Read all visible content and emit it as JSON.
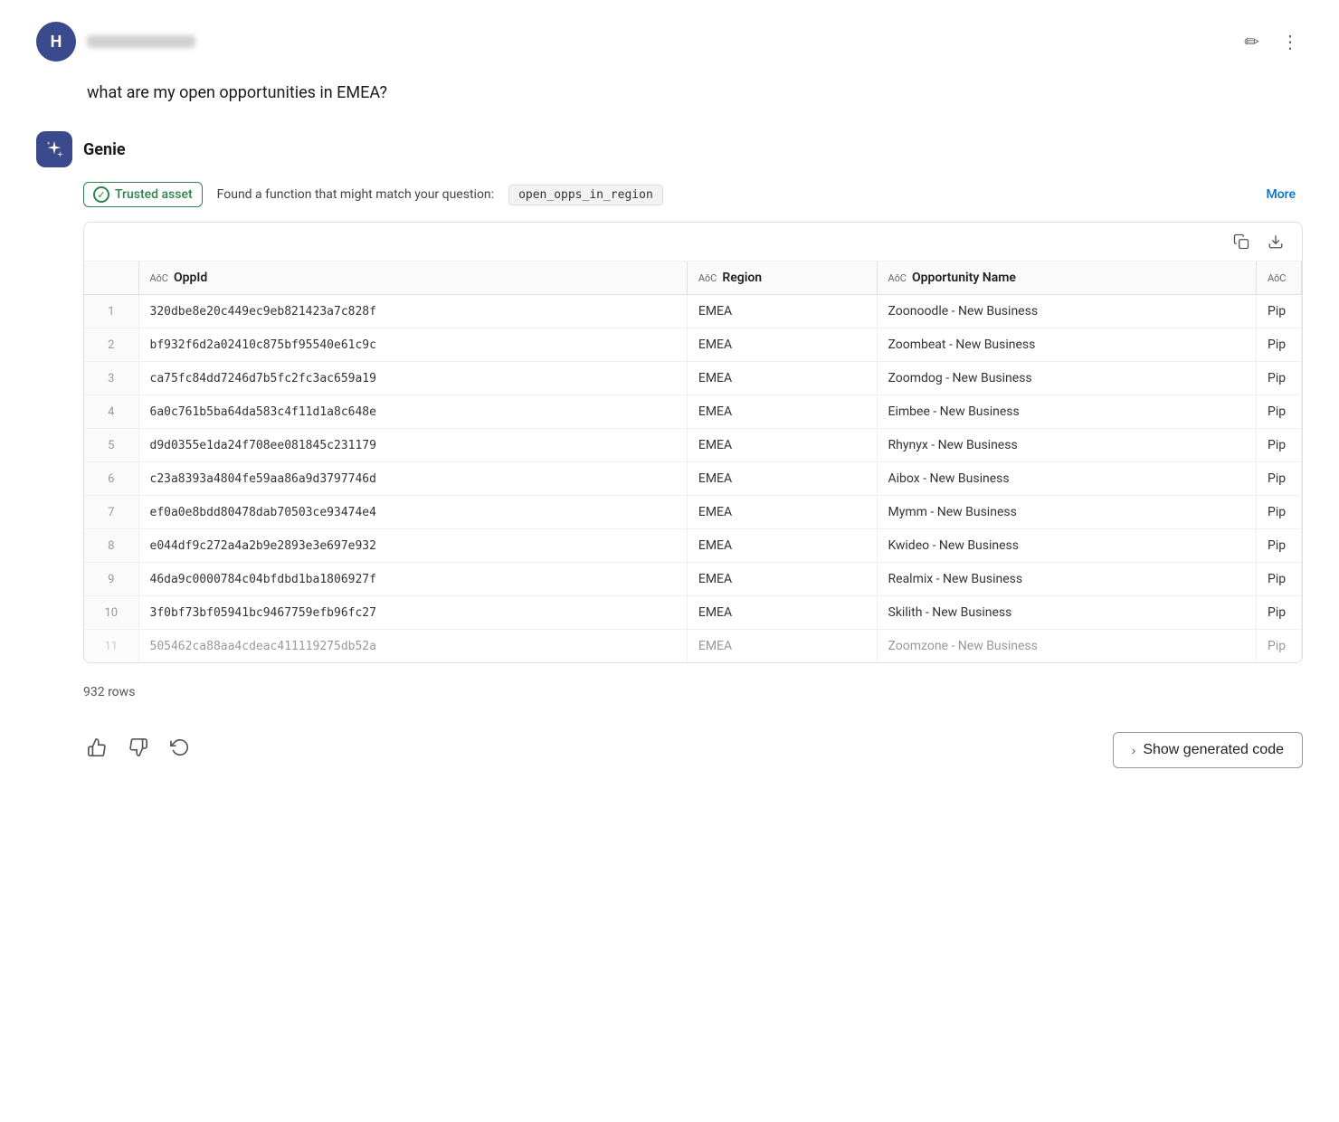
{
  "header": {
    "avatar_letter": "H",
    "edit_icon": "✏",
    "more_icon": "⋮"
  },
  "question": {
    "text": "what are my open opportunities in EMEA?"
  },
  "genie": {
    "name": "Genie",
    "trusted_label": "Trusted asset",
    "found_text": "Found a function that might match your question:",
    "function_name": "open_opps_in_region",
    "more_label": "More"
  },
  "table": {
    "copy_icon": "⧉",
    "download_icon": "↓",
    "columns": [
      {
        "label": "OppId",
        "type": "ABC"
      },
      {
        "label": "Region",
        "type": "ABC"
      },
      {
        "label": "Opportunity Name",
        "type": "ABC"
      },
      {
        "label": "...",
        "type": "ABC"
      }
    ],
    "rows": [
      {
        "num": "1",
        "opp_id": "320dbe8e20c449ec9eb821423a7c828f",
        "region": "EMEA",
        "opp_name": "Zoonoodle - New Business",
        "partial": "Pip"
      },
      {
        "num": "2",
        "opp_id": "bf932f6d2a02410c875bf95540e61c9c",
        "region": "EMEA",
        "opp_name": "Zoombeat - New Business",
        "partial": "Pip"
      },
      {
        "num": "3",
        "opp_id": "ca75fc84dd7246d7b5fc2fc3ac659a19",
        "region": "EMEA",
        "opp_name": "Zoomdog - New Business",
        "partial": "Pip"
      },
      {
        "num": "4",
        "opp_id": "6a0c761b5ba64da583c4f11d1a8c648e",
        "region": "EMEA",
        "opp_name": "Eimbee - New Business",
        "partial": "Pip"
      },
      {
        "num": "5",
        "opp_id": "d9d0355e1da24f708ee081845c231179",
        "region": "EMEA",
        "opp_name": "Rhynyx - New Business",
        "partial": "Pip"
      },
      {
        "num": "6",
        "opp_id": "c23a8393a4804fe59aa86a9d3797746d",
        "region": "EMEA",
        "opp_name": "Aibox - New Business",
        "partial": "Pip"
      },
      {
        "num": "7",
        "opp_id": "ef0a0e8bdd80478dab70503ce93474e4",
        "region": "EMEA",
        "opp_name": "Mymm - New Business",
        "partial": "Pip"
      },
      {
        "num": "8",
        "opp_id": "e044df9c272a4a2b9e2893e3e697e932",
        "region": "EMEA",
        "opp_name": "Kwideo - New Business",
        "partial": "Pip"
      },
      {
        "num": "9",
        "opp_id": "46da9c0000784c04bfdbd1ba1806927f",
        "region": "EMEA",
        "opp_name": "Realmix - New Business",
        "partial": "Pip"
      },
      {
        "num": "10",
        "opp_id": "3f0bf73bf05941bc9467759efb96fc27",
        "region": "EMEA",
        "opp_name": "Skilith - New Business",
        "partial": "Pip"
      },
      {
        "num": "11",
        "opp_id": "505462ca88aa4cdeac411119275db52a",
        "region": "EMEA",
        "opp_name": "Zoomzone - New Business",
        "partial": "Pip"
      }
    ],
    "row_count": "932 rows"
  },
  "footer": {
    "thumbs_up": "👍",
    "thumbs_down": "👎",
    "refresh": "↻",
    "show_code_label": "Show generated code",
    "show_code_chevron": "›"
  }
}
